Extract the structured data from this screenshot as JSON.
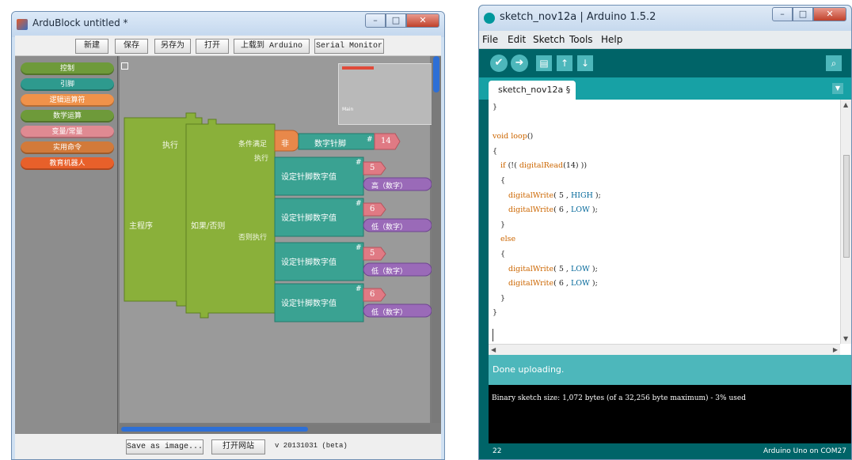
{
  "ardublock": {
    "title": "ArduBlock untitled *",
    "toolbar": {
      "new_label": "新建",
      "save_label": "保存",
      "save_as_label": "另存为",
      "open_label": "打开",
      "upload_label": "上载到 Arduino",
      "serial_label": "Serial Monitor"
    },
    "palette": [
      {
        "label": "控制",
        "color": "#6e9a3a"
      },
      {
        "label": "引脚",
        "color": "#2e9a8e"
      },
      {
        "label": "逻辑运算符",
        "color": "#f0924a"
      },
      {
        "label": "数学运算",
        "color": "#6e9a3a"
      },
      {
        "label": "变量/常量",
        "color": "#e08a92"
      },
      {
        "label": "实用命令",
        "color": "#d27a3a"
      },
      {
        "label": "教育机器人",
        "color": "#e8602a"
      }
    ],
    "blocks": {
      "main_program": "主程序",
      "execute": "执行",
      "if_else": "如果/否则",
      "condition": "条件满足",
      "then_execute": "执行",
      "else_execute": "否则执行",
      "not_label": "非",
      "digital_pin": "数字针脚",
      "hash": "#",
      "pin_14": "14",
      "set_pin_1": "设定针脚数字值",
      "set_pin_2": "设定针脚数字值",
      "set_pin_3": "设定针脚数字值",
      "set_pin_4": "设定针脚数字值",
      "pin_5a": "5",
      "pin_6a": "6",
      "pin_5b": "5",
      "pin_6b": "6",
      "val_high_a": "高（数字）",
      "val_low_a": "低（数字）",
      "val_low_b": "低（数字）",
      "val_low_c": "低（数字）"
    },
    "minimap_label": "Main",
    "status": {
      "save_image_label": "Save as image...",
      "website_label": "打开网站",
      "version": "v 20131031 (beta)"
    }
  },
  "arduino": {
    "title": "sketch_nov12a | Arduino 1.5.2",
    "menus": [
      "File",
      "Edit",
      "Sketch",
      "Tools",
      "Help"
    ],
    "tab_label": "sketch_nov12a §",
    "code": [
      {
        "text": "}",
        "indent": 0
      },
      {
        "text": "",
        "indent": 0
      },
      {
        "text": "void loop()",
        "indent": 0
      },
      {
        "text": "{",
        "indent": 0
      },
      {
        "text": "if (!( digitalRead(14) ))",
        "indent": 1
      },
      {
        "text": "{",
        "indent": 1
      },
      {
        "text": "digitalWrite( 5 , HIGH );",
        "indent": 2
      },
      {
        "text": "digitalWrite( 6 , LOW );",
        "indent": 2
      },
      {
        "text": "}",
        "indent": 1
      },
      {
        "text": "else",
        "indent": 1
      },
      {
        "text": "{",
        "indent": 1
      },
      {
        "text": "digitalWrite( 5 , LOW );",
        "indent": 2
      },
      {
        "text": "digitalWrite( 6 , LOW );",
        "indent": 2
      },
      {
        "text": "}",
        "indent": 1
      },
      {
        "text": "}",
        "indent": 0
      }
    ],
    "status": "Done uploading.",
    "console": "Binary sketch size: 1,072 bytes (of a 32,256 byte maximum) - 3% used",
    "line_number": "22",
    "board": "Arduino Uno on COM27",
    "colors": {
      "teal_dark": "#006468",
      "teal_light": "#4db7bb"
    }
  }
}
